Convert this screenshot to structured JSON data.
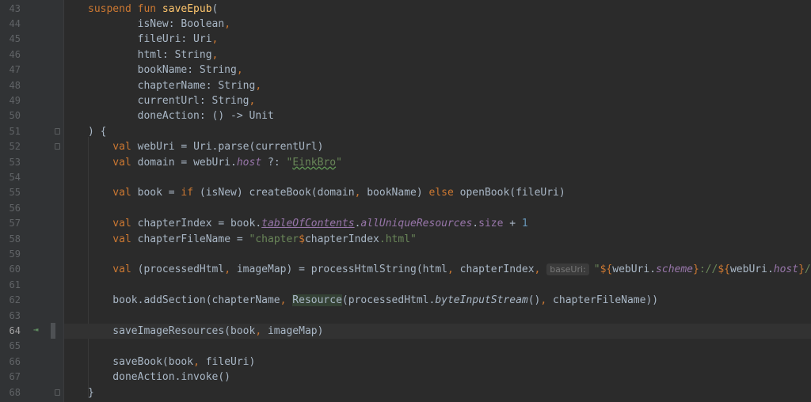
{
  "editor": {
    "current_line": 64,
    "lines": [
      {
        "n": "43",
        "segs": [
          [
            "kw",
            "suspend fun "
          ],
          [
            "fn",
            "saveEpub"
          ],
          [
            "",
            "("
          ]
        ]
      },
      {
        "n": "44",
        "segs": [
          [
            "",
            "        isNew: Boolean"
          ],
          [
            "kw",
            ","
          ]
        ]
      },
      {
        "n": "45",
        "segs": [
          [
            "",
            "        fileUri: Uri"
          ],
          [
            "kw",
            ","
          ]
        ]
      },
      {
        "n": "46",
        "segs": [
          [
            "",
            "        html: String"
          ],
          [
            "kw",
            ","
          ]
        ]
      },
      {
        "n": "47",
        "segs": [
          [
            "",
            "        bookName: String"
          ],
          [
            "kw",
            ","
          ]
        ]
      },
      {
        "n": "48",
        "segs": [
          [
            "",
            "        chapterName: String"
          ],
          [
            "kw",
            ","
          ]
        ]
      },
      {
        "n": "49",
        "segs": [
          [
            "",
            "        currentUrl: String"
          ],
          [
            "kw",
            ","
          ]
        ]
      },
      {
        "n": "50",
        "segs": [
          [
            "",
            "        doneAction: () -> Unit"
          ]
        ]
      },
      {
        "n": "51",
        "segs": [
          [
            "",
            ") {"
          ]
        ]
      },
      {
        "n": "52",
        "segs": [
          [
            "kw",
            "    val "
          ],
          [
            "",
            "webUri = Uri.parse(currentUrl)"
          ]
        ]
      },
      {
        "n": "53",
        "segs": [
          [
            "kw",
            "    val "
          ],
          [
            "",
            "domain = webUri."
          ],
          [
            "prop",
            "host"
          ],
          [
            "",
            " ?: "
          ],
          [
            "str",
            "\""
          ],
          [
            "squiggle",
            "EinkBro"
          ],
          [
            "str",
            "\""
          ]
        ]
      },
      {
        "n": "54",
        "segs": [
          [
            "",
            ""
          ]
        ]
      },
      {
        "n": "55",
        "segs": [
          [
            "kw",
            "    val "
          ],
          [
            "",
            "book = "
          ],
          [
            "kw",
            "if "
          ],
          [
            "",
            "(isNew) createBook(domain"
          ],
          [
            "kw",
            ", "
          ],
          [
            "",
            "bookName) "
          ],
          [
            "kw",
            "else "
          ],
          [
            "",
            "openBook(fileUri)"
          ]
        ]
      },
      {
        "n": "56",
        "segs": [
          [
            "",
            ""
          ]
        ]
      },
      {
        "n": "57",
        "segs": [
          [
            "kw",
            "    val "
          ],
          [
            "",
            "chapterIndex = book."
          ],
          [
            "propul",
            "tableOfContents"
          ],
          [
            "",
            "."
          ],
          [
            "prop",
            "allUniqueResources"
          ],
          [
            "",
            "."
          ],
          [
            "prop2",
            "size"
          ],
          [
            "",
            " + "
          ],
          [
            "num",
            "1"
          ]
        ]
      },
      {
        "n": "58",
        "segs": [
          [
            "kw",
            "    val "
          ],
          [
            "",
            "chapterFileName = "
          ],
          [
            "str",
            "\"chapter"
          ],
          [
            "tmpl",
            "$"
          ],
          [
            "",
            "chapterIndex"
          ],
          [
            "str",
            ".html\""
          ]
        ]
      },
      {
        "n": "59",
        "segs": [
          [
            "",
            ""
          ]
        ]
      },
      {
        "n": "60",
        "segs": [
          [
            "kw",
            "    val "
          ],
          [
            "",
            "(processedHtml"
          ],
          [
            "kw",
            ", "
          ],
          [
            "",
            "imageMap) = processHtmlString(html"
          ],
          [
            "kw",
            ", "
          ],
          [
            "",
            "chapterIndex"
          ],
          [
            "kw",
            ", "
          ],
          [
            "hint",
            "baseUri:"
          ],
          [
            "str",
            "\""
          ],
          [
            "tmpl",
            "${"
          ],
          [
            "",
            "webUri."
          ],
          [
            "prop",
            "scheme"
          ],
          [
            "tmpl",
            "}"
          ],
          [
            "str",
            "://"
          ],
          [
            "tmpl",
            "${"
          ],
          [
            "",
            "webUri."
          ],
          [
            "prop",
            "host"
          ],
          [
            "tmpl",
            "}"
          ],
          [
            "str",
            "/\""
          ],
          [
            "",
            ")"
          ]
        ]
      },
      {
        "n": "61",
        "segs": [
          [
            "",
            ""
          ]
        ]
      },
      {
        "n": "62",
        "segs": [
          [
            "",
            "    book.addSection(chapterName"
          ],
          [
            "kw",
            ", "
          ],
          [
            "resource",
            "Resource"
          ],
          [
            "",
            "(processedHtml."
          ],
          [
            "ext",
            "byteInputStream"
          ],
          [
            "",
            "()"
          ],
          [
            "kw",
            ", "
          ],
          [
            "",
            "chapterFileName))"
          ]
        ]
      },
      {
        "n": "63",
        "segs": [
          [
            "",
            ""
          ]
        ]
      },
      {
        "n": "64",
        "segs": [
          [
            "",
            "    saveImageResources(book"
          ],
          [
            "kw",
            ", "
          ],
          [
            "",
            "imageMap)"
          ]
        ]
      },
      {
        "n": "65",
        "segs": [
          [
            "",
            ""
          ]
        ]
      },
      {
        "n": "66",
        "segs": [
          [
            "",
            "    saveBook(book"
          ],
          [
            "kw",
            ", "
          ],
          [
            "",
            "fileUri)"
          ]
        ]
      },
      {
        "n": "67",
        "segs": [
          [
            "",
            "    doneAction.invoke()"
          ]
        ]
      },
      {
        "n": "68",
        "segs": [
          [
            "",
            "}"
          ]
        ]
      }
    ],
    "fold_lines": [
      "51",
      "52",
      "68"
    ]
  },
  "gutter": {
    "exec_marker_icon": "step-into-icon",
    "exec_marker_glyph": "⇥"
  },
  "colors": {
    "background": "#2b2b2b",
    "keyword": "#cc7832",
    "function": "#ffc66d",
    "string": "#6a8759",
    "number": "#6897bb",
    "property": "#9876aa"
  }
}
